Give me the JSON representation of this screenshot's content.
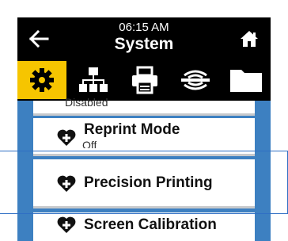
{
  "header": {
    "time": "06:15 AM",
    "title": "System"
  },
  "tabs": [
    {
      "icon": "gear-icon",
      "active": true
    },
    {
      "icon": "network-icon",
      "active": false
    },
    {
      "icon": "printer-icon",
      "active": false
    },
    {
      "icon": "wireless-sensor-icon",
      "active": false
    },
    {
      "icon": "folder-icon",
      "active": false
    }
  ],
  "menu": {
    "items": [
      {
        "label": "",
        "value": "Disabled"
      },
      {
        "label": "Reprint Mode",
        "value": "Off"
      },
      {
        "label": "Precision Printing",
        "value": ""
      },
      {
        "label": "Screen Calibration",
        "value": ""
      }
    ]
  },
  "colors": {
    "background": "#3d80c1",
    "accent": "#f6c500",
    "header": "#000000"
  }
}
